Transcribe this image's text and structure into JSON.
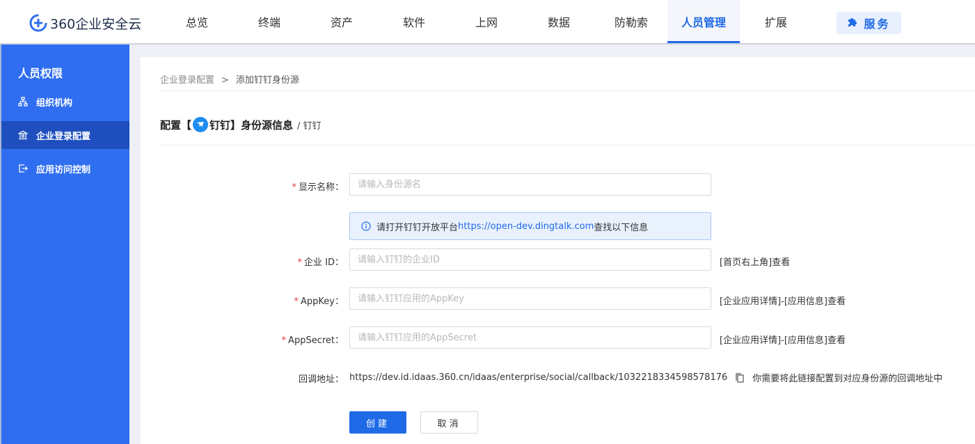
{
  "app": {
    "logo_text": "360企业安全云"
  },
  "nav": {
    "items": [
      {
        "label": "总览"
      },
      {
        "label": "终端"
      },
      {
        "label": "资产"
      },
      {
        "label": "软件"
      },
      {
        "label": "上网"
      },
      {
        "label": "数据"
      },
      {
        "label": "防勒索"
      },
      {
        "label": "人员管理"
      },
      {
        "label": "扩展"
      }
    ],
    "active": "人员管理",
    "service_label": "服务"
  },
  "sidebar": {
    "title": "人员权限",
    "items": [
      {
        "label": "组织机构",
        "icon": "org-tree-icon"
      },
      {
        "label": "企业登录配置",
        "icon": "bank-icon"
      },
      {
        "label": "应用访问控制",
        "icon": "exit-icon"
      }
    ],
    "active": "企业登录配置"
  },
  "breadcrumb": {
    "parent": "企业登录配置",
    "separator": ">",
    "current": "添加钉钉身份源"
  },
  "page": {
    "title_prefix": "配置【",
    "title_provider": "钉钉",
    "title_suffix": "】身份源信息",
    "subtitle": "/ 钉钉"
  },
  "form": {
    "display_name": {
      "label": "显示名称：",
      "placeholder": "请输入身份源名",
      "value": ""
    },
    "info": {
      "text_before": "请打开钉钉开放平台",
      "link": "https://open-dev.dingtalk.com",
      "text_after": "查找以下信息"
    },
    "corp_id": {
      "label": "企业 ID：",
      "placeholder": "请输入钉钉的企业ID",
      "hint": "[首页右上角]查看",
      "value": ""
    },
    "app_key": {
      "label": "AppKey：",
      "placeholder": "请输入钉钉应用的AppKey",
      "hint": "[企业应用详情]-[应用信息]查看",
      "value": ""
    },
    "app_secret": {
      "label": "AppSecret：",
      "placeholder": "请输入钉钉应用的AppSecret",
      "hint": "[企业应用详情]-[应用信息]查看",
      "value": ""
    },
    "callback": {
      "label": "回调地址：",
      "url": "https://dev.id.idaas.360.cn/idaas/enterprise/social/callback/1032218334598578176",
      "note": "你需要将此链接配置到对应身份源的回调地址中"
    },
    "required_mark": "*",
    "create_label": "创建",
    "cancel_label": "取消"
  },
  "colors": {
    "primary": "#1f6ae6",
    "sidebar": "#2f6ef0",
    "sidebar_active": "#1f4fbf",
    "required": "#e0393e",
    "info_bg": "#e9f1fd"
  }
}
